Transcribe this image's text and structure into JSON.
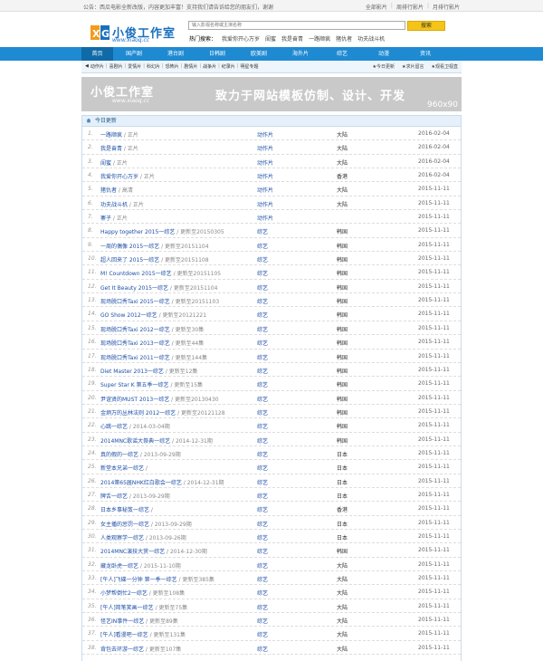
{
  "topbar": {
    "notice": "公告：西瓜电影全新改版，内容更加丰富！支持我们请告诉给您的朋友们，谢谢",
    "links": [
      "全部影片",
      "周排行影片",
      "月排行影片"
    ]
  },
  "header": {
    "logo_name": "小俊工作室",
    "logo_domain": "www.xiaoq.cc",
    "search_placeholder": "输入影视名称或主演名称",
    "search_button": "搜索",
    "hot_label": "热门搜索：",
    "hot_items": [
      "我爱你开心万岁",
      "闺蜜",
      "我是奋青",
      "一路顺疯",
      "猪仇者",
      "功夫战斗机"
    ]
  },
  "nav": {
    "items": [
      "首页",
      "国产剧",
      "港台剧",
      "日韩剧",
      "欧美剧",
      "海外片",
      "综艺",
      "动漫",
      "资讯"
    ]
  },
  "subnav": {
    "left": [
      "动作片",
      "喜剧片",
      "爱情片",
      "科幻片",
      "恐怖片",
      "剧情片",
      "战争片",
      "纪录片",
      "明星专题"
    ],
    "right": [
      "今日更新",
      "求片留言",
      "观看卫视直"
    ]
  },
  "banner": {
    "logo_name": "小俊工作室",
    "logo_domain": "www.xiaoq.cc",
    "slogan": "致力于网站模板仿制、设计、开发",
    "size": "960x90"
  },
  "list": {
    "heading": "今日更新",
    "rows": [
      {
        "idx": "1.",
        "title": "一路顺疯",
        "note": "正片",
        "cat": "动作片",
        "area": "大陆",
        "date": "2016-02-04"
      },
      {
        "idx": "2.",
        "title": "我是奋青",
        "note": "正片",
        "cat": "动作片",
        "area": "大陆",
        "date": "2016-02-04"
      },
      {
        "idx": "3.",
        "title": "闺蜜",
        "note": "正片",
        "cat": "动作片",
        "area": "大陆",
        "date": "2016-02-04"
      },
      {
        "idx": "4.",
        "title": "我爱你开心万岁",
        "note": "正片",
        "cat": "动作片",
        "area": "香港",
        "date": "2016-02-04"
      },
      {
        "idx": "5.",
        "title": "猪仇者",
        "note": "高清",
        "cat": "动作片",
        "area": "大陆",
        "date": "2015-11-11"
      },
      {
        "idx": "6.",
        "title": "功夫战斗机",
        "note": "正片",
        "cat": "动作片",
        "area": "大陆",
        "date": "2015-11-11"
      },
      {
        "idx": "7.",
        "title": "寨子",
        "note": "正片",
        "cat": "动作片",
        "area": "",
        "date": "2015-11-11"
      },
      {
        "idx": "8.",
        "title": "Happy together 2015一综艺",
        "note": "更新至20150305",
        "cat": "综艺",
        "area": "韩国",
        "date": "2015-11-11"
      },
      {
        "idx": "9.",
        "title": "一周的偶像 2015一综艺",
        "note": "更新至20151104",
        "cat": "综艺",
        "area": "韩国",
        "date": "2015-11-11"
      },
      {
        "idx": "10.",
        "title": "超人回来了 2015一综艺",
        "note": "更新至20151108",
        "cat": "综艺",
        "area": "韩国",
        "date": "2015-11-11"
      },
      {
        "idx": "11.",
        "title": "M! Countdown 2015一综艺",
        "note": "更新至20151105",
        "cat": "综艺",
        "area": "韩国",
        "date": "2015-11-11"
      },
      {
        "idx": "12.",
        "title": "Get It Beauty 2015一综艺",
        "note": "更新至20151104",
        "cat": "综艺",
        "area": "韩国",
        "date": "2015-11-11"
      },
      {
        "idx": "13.",
        "title": "现场脱口秀Taxi 2015一综艺",
        "note": "更新至20151103",
        "cat": "综艺",
        "area": "韩国",
        "date": "2015-11-11"
      },
      {
        "idx": "14.",
        "title": "GO Show 2012一综艺",
        "note": "更新至20121221",
        "cat": "综艺",
        "area": "韩国",
        "date": "2015-11-11"
      },
      {
        "idx": "15.",
        "title": "现场脱口秀Taxi 2012一综艺",
        "note": "更新至30集",
        "cat": "综艺",
        "area": "韩国",
        "date": "2015-11-11"
      },
      {
        "idx": "16.",
        "title": "现场脱口秀Taxi 2013一综艺",
        "note": "更新至44集",
        "cat": "综艺",
        "area": "韩国",
        "date": "2015-11-11"
      },
      {
        "idx": "17.",
        "title": "现场脱口秀Taxi 2011一综艺",
        "note": "更新至144集",
        "cat": "综艺",
        "area": "韩国",
        "date": "2015-11-11"
      },
      {
        "idx": "18.",
        "title": "Diet Master 2013一综艺",
        "note": "更新至12集",
        "cat": "综艺",
        "area": "韩国",
        "date": "2015-11-11"
      },
      {
        "idx": "19.",
        "title": "Super Star K 第五季一综艺",
        "note": "更新至15集",
        "cat": "综艺",
        "area": "韩国",
        "date": "2015-11-11"
      },
      {
        "idx": "20.",
        "title": "尹谊贤的MUST 2013一综艺",
        "note": "更新至20130430",
        "cat": "综艺",
        "area": "韩国",
        "date": "2015-11-11"
      },
      {
        "idx": "21.",
        "title": "金炳万的丛林法则 2012一综艺",
        "note": "更新至20121128",
        "cat": "综艺",
        "area": "韩国",
        "date": "2015-11-11"
      },
      {
        "idx": "22.",
        "title": "心跳一综艺",
        "note": "2014-03-04期",
        "cat": "综艺",
        "area": "韩国",
        "date": "2015-11-11"
      },
      {
        "idx": "23.",
        "title": "2014MNC歌谣大祭典一综艺",
        "note": "2014-12-31期",
        "cat": "综艺",
        "area": "韩国",
        "date": "2015-11-11"
      },
      {
        "idx": "24.",
        "title": "真的假的一综艺",
        "note": "2013-09-29期",
        "cat": "综艺",
        "area": "日本",
        "date": "2015-11-11"
      },
      {
        "idx": "25.",
        "title": "新堂本兄弟一综艺",
        "note": "",
        "cat": "综艺",
        "area": "日本",
        "date": "2015-11-11"
      },
      {
        "idx": "26.",
        "title": "2014第65届NHK红白歌会一综艺",
        "note": "2014-12-31期",
        "cat": "综艺",
        "area": "日本",
        "date": "2015-11-11"
      },
      {
        "idx": "27.",
        "title": "牌舌一综艺",
        "note": "2013-09-29期",
        "cat": "综艺",
        "area": "日本",
        "date": "2015-11-11"
      },
      {
        "idx": "28.",
        "title": "日本乡事秘笈一综艺",
        "note": "",
        "cat": "综艺",
        "area": "香港",
        "date": "2015-11-11"
      },
      {
        "idx": "29.",
        "title": "女主播的惩罚一综艺",
        "note": "2013-09-29期",
        "cat": "综艺",
        "area": "日本",
        "date": "2015-11-11"
      },
      {
        "idx": "30.",
        "title": "人类观察学一综艺",
        "note": "2013-09-26期",
        "cat": "综艺",
        "area": "日本",
        "date": "2015-11-11"
      },
      {
        "idx": "31.",
        "title": "2014MNC演技大赏一综艺",
        "note": "2014-12-30期",
        "cat": "综艺",
        "area": "韩国",
        "date": "2015-11-11"
      },
      {
        "idx": "32.",
        "title": "藏龙卧虎一综艺",
        "note": "2015-11-10期",
        "cat": "综艺",
        "area": "大陆",
        "date": "2015-11-11"
      },
      {
        "idx": "33.",
        "title": "[午人]飞碟一分钟 第一季一综艺",
        "note": "更新至385集",
        "cat": "综艺",
        "area": "大陆",
        "date": "2015-11-11"
      },
      {
        "idx": "34.",
        "title": "小梦帮倒忙2一综艺",
        "note": "更新至108集",
        "cat": "综艺",
        "area": "大陆",
        "date": "2015-11-11"
      },
      {
        "idx": "35.",
        "title": "[午人]简笔笑画一综艺",
        "note": "更新至75集",
        "cat": "综艺",
        "area": "大陆",
        "date": "2015-11-11"
      },
      {
        "idx": "36.",
        "title": "怪艺IN事件一综艺",
        "note": "更新至89集",
        "cat": "综艺",
        "area": "大陆",
        "date": "2015-11-11"
      },
      {
        "idx": "37.",
        "title": "[午人]看漫吧一综艺",
        "note": "更新至131集",
        "cat": "综艺",
        "area": "大陆",
        "date": "2015-11-11"
      },
      {
        "idx": "38.",
        "title": "背包去环游一综艺",
        "note": "更新至107集",
        "cat": "综艺",
        "area": "大陆",
        "date": "2015-11-11"
      }
    ]
  }
}
